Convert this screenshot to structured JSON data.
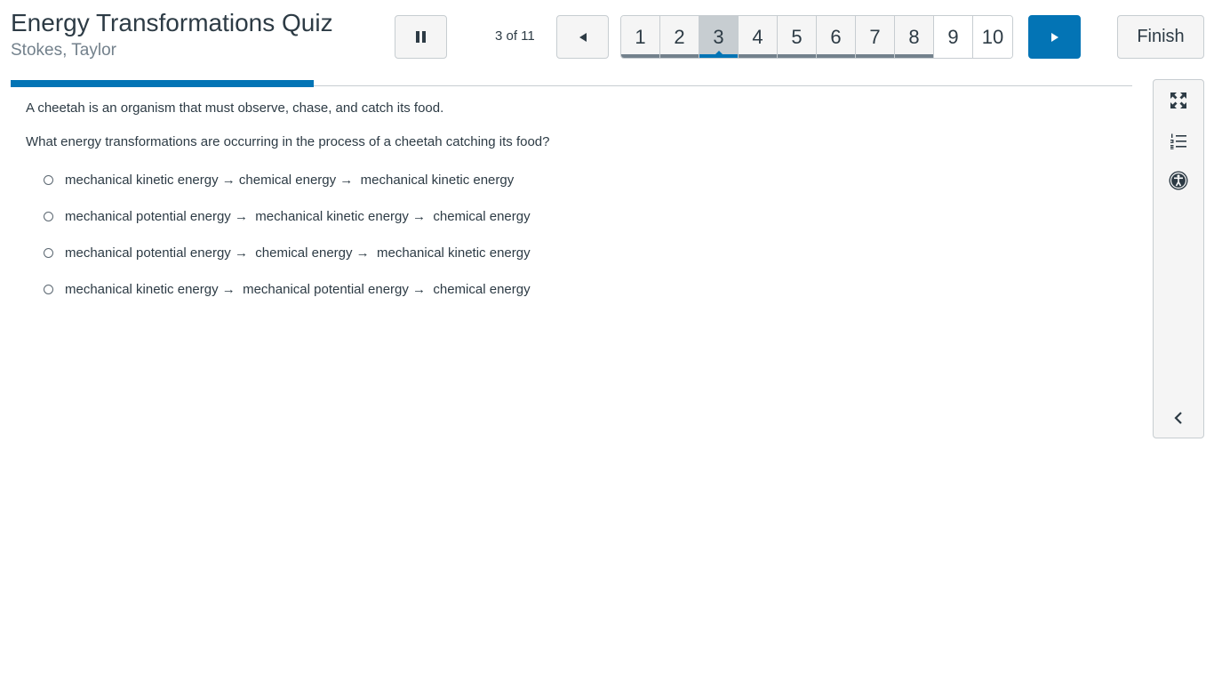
{
  "header": {
    "title": "Energy Transformations Quiz",
    "student": "Stokes, Taylor",
    "counter": "3 of 11",
    "finish_label": "Finish"
  },
  "pager": {
    "pages": [
      "1",
      "2",
      "3",
      "4",
      "5",
      "6",
      "7",
      "8",
      "9",
      "10"
    ],
    "current": 3,
    "answered": [
      1,
      2,
      4,
      5,
      6,
      7,
      8
    ]
  },
  "progress": {
    "fraction": 0.27
  },
  "question": {
    "stem": "A cheetah is an organism that must observe, chase, and catch its food.",
    "prompt": "What energy transformations are occurring in the process of a cheetah catching its food?",
    "choices": [
      "mechanical kinetic energy → chemical energy →  mechanical kinetic energy",
      "mechanical potential energy →  mechanical kinetic energy →  chemical energy",
      "mechanical potential energy →  chemical energy →  mechanical kinetic energy",
      "mechanical kinetic energy →  mechanical potential energy →  chemical energy"
    ]
  },
  "icons": {
    "pause": "pause-icon",
    "prev": "caret-left-icon",
    "next": "caret-right-icon",
    "expand": "expand-icon",
    "list": "numbered-list-icon",
    "accessibility": "accessibility-icon",
    "collapse": "chevron-left-icon"
  },
  "colors": {
    "accent": "#0374b5",
    "text": "#2d3b45",
    "muted": "#73818c",
    "border": "#c7cdd1"
  }
}
